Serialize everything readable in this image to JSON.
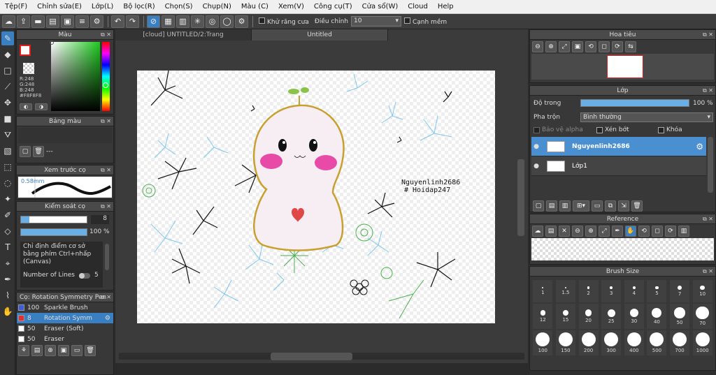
{
  "menu": [
    "Tệp(F)",
    "Chỉnh sửa(E)",
    "Lớp(L)",
    "Bộ lọc(R)",
    "Chọn(S)",
    "Chụp(N)",
    "Màu (C)",
    "Xem(V)",
    "Công cụ(T)",
    "Cửa sổ(W)",
    "Cloud",
    "Help"
  ],
  "toolbar": {
    "antialias": "Khử răng cưa",
    "adjust": "Điều chỉnh",
    "adjust_value": "10",
    "smooth": "Cạnh mềm"
  },
  "tabs": [
    "[cloud] UNTITLED/2:Trang",
    "Untitled"
  ],
  "color_panel": {
    "title": "Màu",
    "r": "R:248",
    "g": "G:248",
    "b": "B:248",
    "hex": "#F8F8F8"
  },
  "palette": {
    "title": "Bảng màu",
    "value": "---"
  },
  "brush_preview": {
    "title": "Xem trước cọ",
    "size": "0.58mm"
  },
  "brush_control": {
    "title": "Kiểm soát cọ",
    "size_value": "8",
    "opacity_value": "100 %",
    "hint": "Chỉ định điểm cơ sở bằng phím Ctrl+nhấp (Canvas)",
    "lines_label": "Number of Lines",
    "lines_value": "5"
  },
  "brush_list": {
    "title": "Cọ: Rotation Symmetry Pen",
    "items": [
      {
        "size": "100",
        "name": "Sparkle Brush",
        "color": "#3b5bdb"
      },
      {
        "size": "8",
        "name": "Rotation Symm",
        "color": "#e03030",
        "active": true
      },
      {
        "size": "50",
        "name": "Eraser (Soft)",
        "color": "#ffffff"
      },
      {
        "size": "50",
        "name": "Eraser",
        "color": "#ffffff"
      }
    ]
  },
  "artwork": {
    "signature_1": "Nguyenlinh2686",
    "signature_2": "# Hoidap247"
  },
  "navigator": {
    "title": "Hoa tiêu"
  },
  "layer_panel": {
    "title": "Lớp",
    "opacity_label": "Độ trong",
    "opacity_value": "100 %",
    "opacity": 1.0,
    "blend_label": "Pha trộn",
    "blend_value": "Bình thường",
    "protect_alpha": "Bảo vệ alpha",
    "clip": "Xén bớt",
    "lock": "Khóa",
    "layers": [
      {
        "name": "Nguyenlinh2686",
        "active": true
      },
      {
        "name": "Lớp1",
        "active": false
      }
    ]
  },
  "reference": {
    "title": "Reference"
  },
  "brush_size": {
    "title": "Brush Size",
    "sizes": [
      "1",
      "1.5",
      "2",
      "3",
      "4",
      "5",
      "7",
      "10",
      "12",
      "15",
      "20",
      "25",
      "30",
      "40",
      "50",
      "70",
      "100",
      "150",
      "200",
      "300",
      "400",
      "500",
      "700",
      "1000"
    ]
  },
  "colors": {
    "accent": "#3a7fc1",
    "layer_active": "#4a8fd0"
  }
}
